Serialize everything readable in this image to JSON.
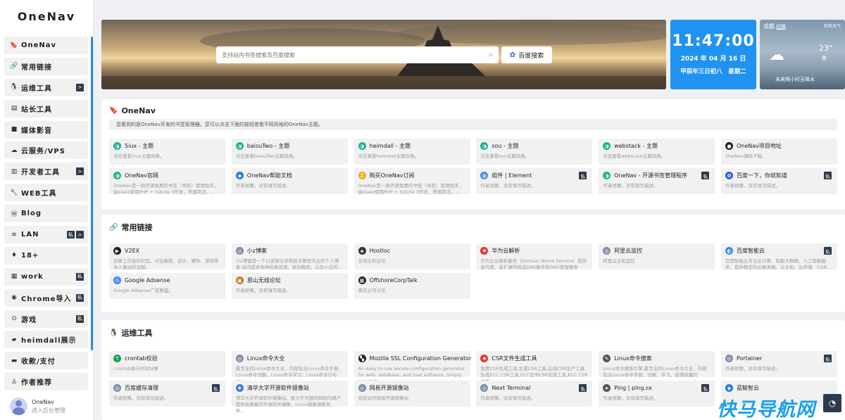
{
  "sidebar": {
    "logo": "OneNav",
    "items": [
      {
        "icon": "🔖",
        "label": "OneNav",
        "badges": []
      },
      {
        "icon": "🔗",
        "label": "常用链接",
        "badges": []
      },
      {
        "icon": "🐧",
        "label": "运维工具",
        "badges": [
          ">"
        ]
      },
      {
        "icon": "▤",
        "label": "站长工具",
        "badges": []
      },
      {
        "icon": "■",
        "label": "媒体影音",
        "badges": []
      },
      {
        "icon": "☁",
        "label": "云服务/VPS",
        "badges": []
      },
      {
        "icon": "▥",
        "label": "开发者工具",
        "badges": [
          ">"
        ]
      },
      {
        "icon": "🔧",
        "label": "WEB工具",
        "badges": []
      },
      {
        "icon": "Ⓦ",
        "label": "Blog",
        "badges": []
      },
      {
        "icon": "≋",
        "label": "LAN",
        "badges": [
          "私",
          ">"
        ]
      },
      {
        "icon": "♦",
        "label": "18+",
        "badges": []
      },
      {
        "icon": "▦",
        "label": "work",
        "badges": [
          "私"
        ]
      },
      {
        "icon": "◉",
        "label": "Chrome导入",
        "badges": [
          "私"
        ]
      },
      {
        "icon": "⊙",
        "label": "游戏",
        "badges": [
          "私"
        ]
      },
      {
        "icon": "▰",
        "label": "heimdall展示",
        "badges": []
      },
      {
        "icon": "▬",
        "label": "收款/支付",
        "badges": []
      },
      {
        "icon": "♙",
        "label": "作者推荐",
        "badges": []
      }
    ],
    "user": {
      "name": "OneNav",
      "sub": "进入后台管理"
    }
  },
  "search": {
    "placeholder": "支持站内书签搜索及百度搜索",
    "button": "百度搜索"
  },
  "clock": {
    "time": "11:47:00",
    "date": "2024 年 04 月 16 日",
    "lunar": "甲辰年三日初八　星期二"
  },
  "weather": {
    "city": "成都",
    "switch": "切换",
    "top_right": "和风天气",
    "temp": "23°",
    "cond": "雾",
    "forecast": "未来两小时无降水"
  },
  "sections": [
    {
      "title": "OneNav",
      "icon": "🔖",
      "desc": "您看到的是OneNav开发的书签管理器。您可以点击下面的按钮查看不同风格的OneNav主题。",
      "cards": [
        {
          "title": "5iux - 主题",
          "desc": "点击查看5iux主题风格。",
          "icon_color": "#1ab394",
          "icon": "◑",
          "private": false
        },
        {
          "title": "baisuTwo - 主题",
          "desc": "点击查看baisuTwo主题风格。",
          "icon_color": "#1ab394",
          "icon": "◑",
          "private": false
        },
        {
          "title": "heimdall - 主题",
          "desc": "点击查看heimdall主题风格。",
          "icon_color": "#1ab394",
          "icon": "◑",
          "private": false
        },
        {
          "title": "sou - 主题",
          "desc": "点击查看sou主题风格。",
          "icon_color": "#1ab394",
          "icon": "◑",
          "private": false
        },
        {
          "title": "webstack - 主题",
          "desc": "点击查看webstack主题风格。",
          "icon_color": "#1ab394",
          "icon": "◑",
          "private": false
        },
        {
          "title": "OneNav项目地址",
          "desc": "OneNav源码下载。",
          "icon_color": "#222222",
          "icon": "●",
          "private": false
        },
        {
          "title": "OneNav官网",
          "desc": "OneNav是一款开源免费的书签（导航）管理程序，由xiaoz使用PHP + SQLite 3开发，界面简洁，…",
          "icon_color": "#1ab394",
          "icon": "◑",
          "private": false
        },
        {
          "title": "OneNav帮助文档",
          "desc": "作者很懒，没有填写描述。",
          "icon_color": "#2b7bd6",
          "icon": "◆",
          "private": false
        },
        {
          "title": "购买OneNav订阅",
          "desc": "OneNav是一款开源免费的书签（导航）管理程序，由xiaoz使用PHP + SQLite 3开发，界面简洁，…",
          "icon_color": "#e8b21b",
          "icon": "Z",
          "private": false
        },
        {
          "title": "组件 | Element",
          "desc": "作者很懒，没有填写描述。",
          "icon_color": "#4a8fe0",
          "icon": "◍",
          "private": true
        },
        {
          "title": "OneNav - 开源书签管理程序",
          "desc": "作者很懒，没有填写描述。",
          "icon_color": "#1ab394",
          "icon": "◑",
          "private": true
        },
        {
          "title": "百度一下，你就知道",
          "desc": "作者很懒，没有填写描述。",
          "icon_color": "#2b5dd6",
          "icon": "✿",
          "private": true
        }
      ]
    },
    {
      "title": "常用链接",
      "icon": "🔗",
      "cards": [
        {
          "title": "V2EX",
          "desc": "创意工作者的社区。讨论编程、设计、硬件、游戏等令人激动的话题。",
          "icon_color": "#222222",
          "icon": "▶",
          "private": false
        },
        {
          "title": "小z博客",
          "desc": "小z博客是一个以资源分享和技术教程为主的个人博客,站内提供各种优质资源、原创教程，以及小白的…",
          "icon_color": "#7f8ba8",
          "icon": "◎",
          "private": false
        },
        {
          "title": "Hostloc",
          "desc": "全球主机论坛",
          "icon_color": "#333333",
          "icon": "◈",
          "private": false
        },
        {
          "title": "华为云解析",
          "desc": "华为云云解析服务（Domain Name Service）提供高可用、高扩展的权威DNS服务和DNS管理服务",
          "icon_color": "#e0322b",
          "icon": "✾",
          "private": false
        },
        {
          "title": "阿里云监控",
          "desc": "阿里云主机监控",
          "icon_color": "#7f8ba8",
          "icon": "◎",
          "private": false
        },
        {
          "title": "百度智能云",
          "desc": "百度智能云专注云计算、智能大数据、人工智能服务，提供稳定的云服务器、云主机、云存储、CDN…",
          "icon_color": "#3a8ee6",
          "icon": "◐",
          "private": true
        },
        {
          "title": "Google Adsense",
          "desc": "Google Adsense广告联盟。",
          "icon_color": "#4285f4",
          "icon": "G",
          "private": false
        },
        {
          "title": "恩山无线论坛",
          "desc": "作者很懒，没有填写描述。",
          "icon_color": "#c87a1a",
          "icon": "▣",
          "private": false
        },
        {
          "title": "OffshoreCorpTalk",
          "desc": "离岸公司讨论",
          "icon_color": "#222222",
          "icon": "▦",
          "private": false
        }
      ]
    },
    {
      "title": "运维工具",
      "icon": "🐧",
      "cards": [
        {
          "title": "crontab校验",
          "desc": "crontab执行时间计算",
          "icon_color": "#1aa05a",
          "icon": "T",
          "private": false
        },
        {
          "title": "Linux命令大全",
          "desc": "最专业的Linux命令大全，内容包含Linux命令手册、Linux命令详解、Linux命令学习、Linux命令行与she…",
          "icon_color": "#7f8ba8",
          "icon": "◎",
          "private": false
        },
        {
          "title": "Mozilla SSL Configuration Generator",
          "desc": "An easy-to-use secure configuration generator for web, database, and mail software. Simply select th…",
          "icon_color": "#222222",
          "icon": "▚",
          "private": false
        },
        {
          "title": "CSR文件生成工具",
          "desc": "免费CSR生成工具,生成CSR工具,在线CSR生产工具,生成ECC CSR工具,ECC证书CSR生成工具,ECC CSR文件…",
          "icon_color": "#e0322b",
          "icon": "✚",
          "private": false
        },
        {
          "title": "Linux命令搜索",
          "desc": "Linux命令搜索引擎,最专业的Linux命令大全，内容包含Linux命令手册、详解、学习，值得收藏的Linux…",
          "icon_color": "#555555",
          "icon": "✎",
          "private": false
        },
        {
          "title": "Portainer",
          "desc": "作者很懒，没有填写描述。",
          "icon_color": "#7f8ba8",
          "icon": "◎",
          "private": true
        },
        {
          "title": "百度缓存清理",
          "desc": "作者很懒，没有填写描述。",
          "icon_color": "#7f8ba8",
          "icon": "◎",
          "private": true
        },
        {
          "title": "清华大学开源软件镜像站",
          "desc": "清华大学开源软件镜像站，致力于为国内和校内用户提供高质量的开源软件镜像、Linux镜像源服务，帮…",
          "icon_color": "#3a7bd5",
          "icon": "❖",
          "private": false
        },
        {
          "title": "网易开源镜像站",
          "desc": "欢迎访问网易开源镜像站",
          "icon_color": "#7f8ba8",
          "icon": "◎",
          "private": false
        },
        {
          "title": "Next Terminal",
          "desc": "作者很懒，没有填写描述。",
          "icon_color": "#7f8ba8",
          "icon": "◎",
          "private": true
        },
        {
          "title": "Ping | ping.sx",
          "desc": "作者很懒，没有填写描述。",
          "icon_color": "#555555",
          "icon": "➤",
          "private": true
        },
        {
          "title": "蓝鲸智云",
          "desc": "",
          "icon_color": "#1a7ee0",
          "icon": "◆",
          "private": false
        }
      ]
    }
  ],
  "badge_private": "私",
  "watermark": "快马导航网",
  "float_icon": "◔"
}
